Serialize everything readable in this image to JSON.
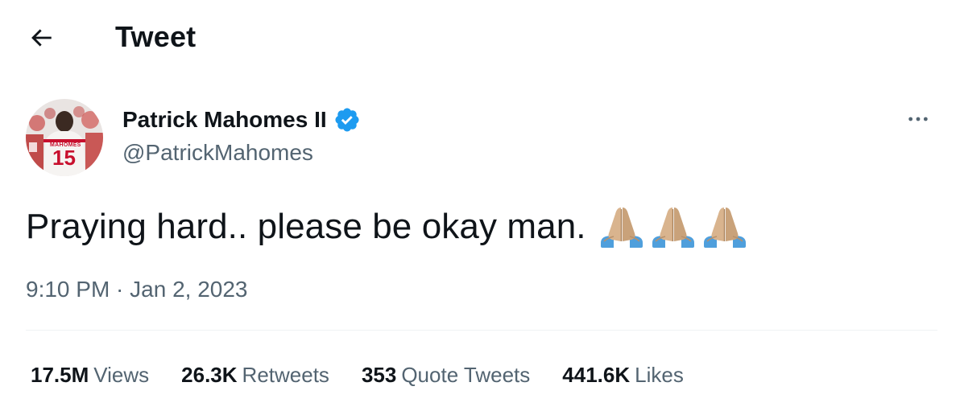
{
  "header": {
    "title": "Tweet",
    "back_icon": "arrow-left-icon"
  },
  "tweet": {
    "author": {
      "display_name": "Patrick Mahomes II",
      "handle": "@PatrickMahomes",
      "verified": true,
      "avatar_jersey_name": "MAHOMES",
      "avatar_jersey_number": "15"
    },
    "text": "Praying hard.. please be okay man.",
    "emojis": [
      "folded-hands-emoji",
      "folded-hands-emoji",
      "folded-hands-emoji"
    ],
    "timestamp": "9:10 PM · Jan 2, 2023",
    "more_icon": "more-horizontal-icon"
  },
  "stats": [
    {
      "count": "17.5M",
      "label": "Views"
    },
    {
      "count": "26.3K",
      "label": "Retweets"
    },
    {
      "count": "353",
      "label": "Quote Tweets"
    },
    {
      "count": "441.6K",
      "label": "Likes"
    }
  ],
  "colors": {
    "text_primary": "#0f1419",
    "text_secondary": "#536471",
    "verified_blue": "#1d9bf0",
    "divider": "#eff3f4"
  }
}
